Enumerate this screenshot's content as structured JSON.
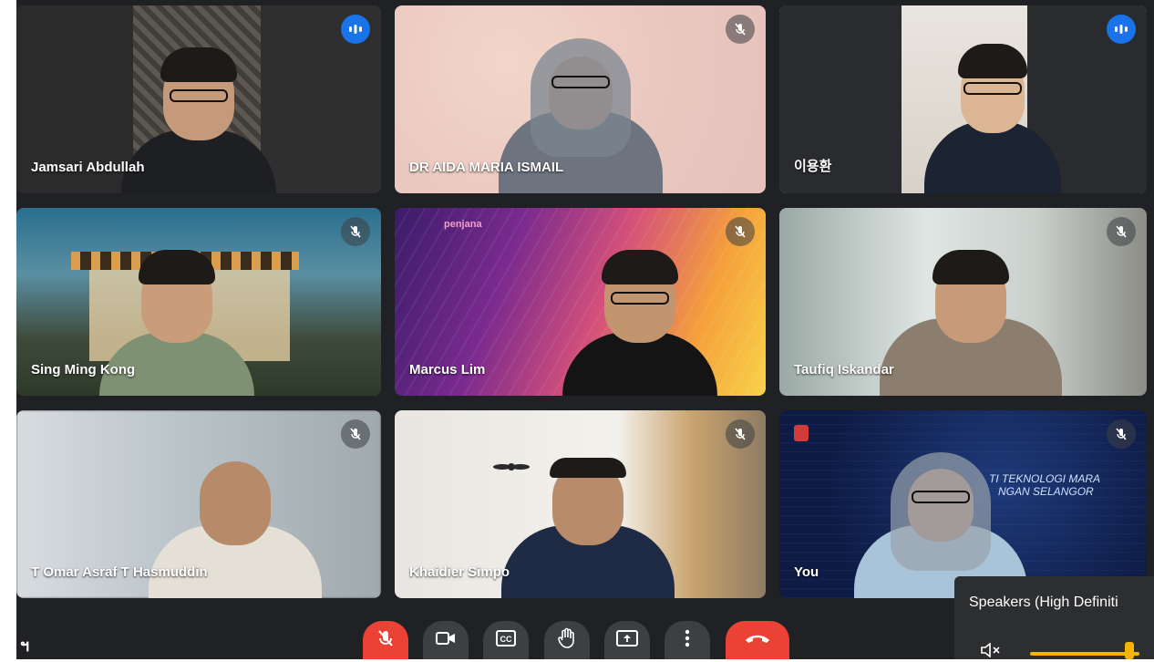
{
  "participants": [
    {
      "name": "Jamsari Abdullah",
      "status": "speaking"
    },
    {
      "name": "DR AIDA MARIA ISMAIL",
      "status": "muted"
    },
    {
      "name": "이용환",
      "status": "speaking",
      "active": true
    },
    {
      "name": "Sing Ming Kong",
      "status": "muted"
    },
    {
      "name": "Marcus Lim",
      "status": "muted",
      "bg_logo_text": "penjana"
    },
    {
      "name": "Taufiq Iskandar",
      "status": "muted"
    },
    {
      "name": "T Omar Asraf T Hasmuddin",
      "status": "muted"
    },
    {
      "name": "Khaidier Simpo",
      "status": "muted"
    },
    {
      "name": "You",
      "status": "muted",
      "bg_text_1": "TI TEKNOLOGI MARA",
      "bg_text_2": "NGAN SELANGOR"
    }
  ],
  "toolbar": {
    "buttons": [
      "mic-off-icon",
      "camera-icon",
      "captions-icon",
      "raise-hand-icon",
      "present-icon",
      "more-options-icon",
      "end-call-icon"
    ]
  },
  "audio_panel": {
    "label": "Speakers (High Definiti",
    "volume_level": 0.85,
    "muted_icon": "volume-muted-icon"
  },
  "corner_label": "ฯ",
  "colors": {
    "accent": "#1a73e8",
    "end_call": "#ea4335",
    "stage_bg": "#202124",
    "slider": "#f5b400"
  }
}
